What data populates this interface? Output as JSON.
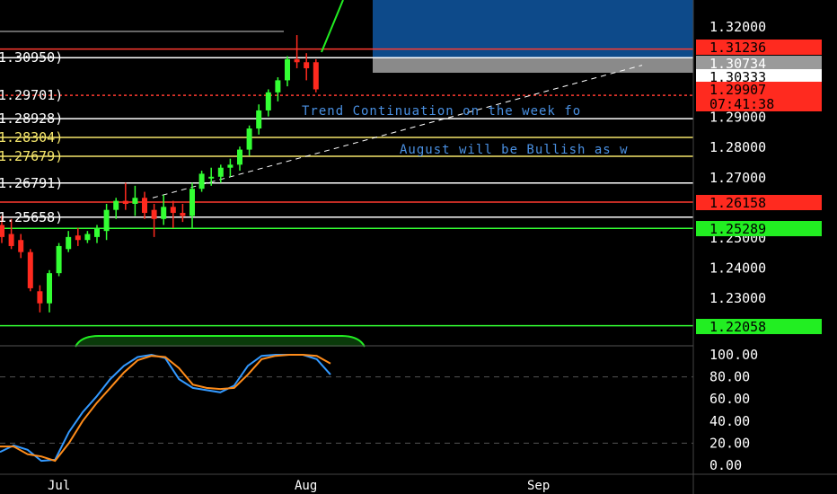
{
  "chart_data": [
    {
      "type": "candlestick",
      "ylim": [
        1.218,
        1.3275
      ],
      "y_ticks": [
        "1.32000",
        "1.29000",
        "1.28000",
        "1.27000",
        "1.25000",
        "1.24000",
        "1.23000"
      ],
      "x_labels": [
        "Jul",
        "Aug",
        "Sep"
      ],
      "candles": [
        {
          "o": 1.254,
          "h": 1.257,
          "l": 1.248,
          "c": 1.25
        },
        {
          "o": 1.251,
          "h": 1.256,
          "l": 1.246,
          "c": 1.247
        },
        {
          "o": 1.249,
          "h": 1.251,
          "l": 1.243,
          "c": 1.245
        },
        {
          "o": 1.245,
          "h": 1.246,
          "l": 1.232,
          "c": 1.233
        },
        {
          "o": 1.232,
          "h": 1.234,
          "l": 1.225,
          "c": 1.228
        },
        {
          "o": 1.228,
          "h": 1.239,
          "l": 1.225,
          "c": 1.238
        },
        {
          "o": 1.238,
          "h": 1.248,
          "l": 1.237,
          "c": 1.247
        },
        {
          "o": 1.246,
          "h": 1.252,
          "l": 1.245,
          "c": 1.25
        },
        {
          "o": 1.2505,
          "h": 1.253,
          "l": 1.247,
          "c": 1.249
        },
        {
          "o": 1.249,
          "h": 1.252,
          "l": 1.248,
          "c": 1.251
        },
        {
          "o": 1.25,
          "h": 1.254,
          "l": 1.248,
          "c": 1.253
        },
        {
          "o": 1.252,
          "h": 1.261,
          "l": 1.249,
          "c": 1.259
        },
        {
          "o": 1.259,
          "h": 1.263,
          "l": 1.256,
          "c": 1.262
        },
        {
          "o": 1.262,
          "h": 1.268,
          "l": 1.259,
          "c": 1.261
        },
        {
          "o": 1.261,
          "h": 1.267,
          "l": 1.257,
          "c": 1.263
        },
        {
          "o": 1.263,
          "h": 1.265,
          "l": 1.256,
          "c": 1.258
        },
        {
          "o": 1.259,
          "h": 1.261,
          "l": 1.25,
          "c": 1.256
        },
        {
          "o": 1.256,
          "h": 1.264,
          "l": 1.254,
          "c": 1.26
        },
        {
          "o": 1.26,
          "h": 1.262,
          "l": 1.253,
          "c": 1.258
        },
        {
          "o": 1.258,
          "h": 1.261,
          "l": 1.255,
          "c": 1.257
        },
        {
          "o": 1.257,
          "h": 1.268,
          "l": 1.253,
          "c": 1.266
        },
        {
          "o": 1.266,
          "h": 1.272,
          "l": 1.265,
          "c": 1.271
        },
        {
          "o": 1.27,
          "h": 1.273,
          "l": 1.267,
          "c": 1.27
        },
        {
          "o": 1.27,
          "h": 1.274,
          "l": 1.268,
          "c": 1.273
        },
        {
          "o": 1.273,
          "h": 1.276,
          "l": 1.27,
          "c": 1.274
        },
        {
          "o": 1.274,
          "h": 1.28,
          "l": 1.272,
          "c": 1.279
        },
        {
          "o": 1.279,
          "h": 1.287,
          "l": 1.277,
          "c": 1.286
        },
        {
          "o": 1.286,
          "h": 1.294,
          "l": 1.284,
          "c": 1.292
        },
        {
          "o": 1.292,
          "h": 1.299,
          "l": 1.29,
          "c": 1.298
        },
        {
          "o": 1.298,
          "h": 1.303,
          "l": 1.295,
          "c": 1.302
        },
        {
          "o": 1.302,
          "h": 1.31,
          "l": 1.3,
          "c": 1.309
        },
        {
          "o": 1.309,
          "h": 1.317,
          "l": 1.306,
          "c": 1.308
        },
        {
          "o": 1.308,
          "h": 1.311,
          "l": 1.302,
          "c": 1.306
        },
        {
          "o": 1.308,
          "h": 1.309,
          "l": 1.298,
          "c": 1.299
        }
      ],
      "horizontal_levels": [
        {
          "price": 1.31236,
          "color": "#ff3b30"
        },
        {
          "price": 1.3095,
          "color": "#ffffff"
        },
        {
          "price": 1.29701,
          "color": "#ff3b30",
          "dashed": true
        },
        {
          "price": 1.28928,
          "color": "#ffffff"
        },
        {
          "price": 1.28304,
          "color": "#f5e66b"
        },
        {
          "price": 1.27679,
          "color": "#f5e66b"
        },
        {
          "price": 1.26791,
          "color": "#ffffff"
        },
        {
          "price": 1.26158,
          "color": "#ff3b30"
        },
        {
          "price": 1.25658,
          "color": "#ffffff"
        },
        {
          "price": 1.25289,
          "color": "#33ff33"
        },
        {
          "price": 1.22058,
          "color": "#33ff33"
        }
      ],
      "level_labels_left": [
        "1.30950)",
        "1.29701)",
        "1.28928)",
        "1.28304)",
        "1.27679)",
        "1.26791)",
        "1.25658)"
      ],
      "price_tags": [
        {
          "label": "1.31236",
          "bg": "#ff2a1f",
          "fg": "#000000"
        },
        {
          "label": "1.30734",
          "bg": "#9a9a9a",
          "fg": "#ffffff"
        },
        {
          "label": "1.30333",
          "bg": "#ffffff",
          "fg": "#000000"
        },
        {
          "label": "1.29907",
          "bg": "#ff2a1f",
          "fg": "#000000"
        },
        {
          "label": "07:41:38",
          "bg": "#ff2a1f",
          "fg": "#000000"
        },
        {
          "label": "1.26158",
          "bg": "#ff2a1f",
          "fg": "#000000"
        },
        {
          "label": "1.25289",
          "bg": "#22ee22",
          "fg": "#000000"
        },
        {
          "label": "1.22058",
          "bg": "#22ee22",
          "fg": "#000000"
        }
      ],
      "annotations": [
        "Trend Continuation on the week fo",
        "August will be Bullish as w"
      ],
      "colors": {
        "up": "#33ff33",
        "down": "#ff2a1f",
        "zone": "#0d4a8a",
        "zone_grey": "#8a8a8a",
        "annotation": "#4a90e2"
      }
    },
    {
      "type": "line",
      "ylim": [
        0,
        100
      ],
      "y_ticks": [
        "100.00",
        "80.00",
        "60.00",
        "40.00",
        "20.00",
        "0.00"
      ],
      "reference_levels": [
        80,
        20
      ],
      "series": [
        {
          "color": "#3399ff",
          "values": [
            12,
            18,
            14,
            4,
            5,
            30,
            48,
            62,
            78,
            90,
            98,
            100,
            97,
            78,
            70,
            68,
            66,
            72,
            90,
            99,
            100,
            100,
            100,
            96,
            82
          ]
        },
        {
          "color": "#ff8c1a",
          "values": [
            17,
            17,
            10,
            8,
            4,
            20,
            40,
            56,
            70,
            84,
            95,
            99,
            98,
            88,
            73,
            70,
            69,
            70,
            82,
            96,
            99,
            100,
            100,
            99,
            92
          ]
        }
      ]
    }
  ]
}
